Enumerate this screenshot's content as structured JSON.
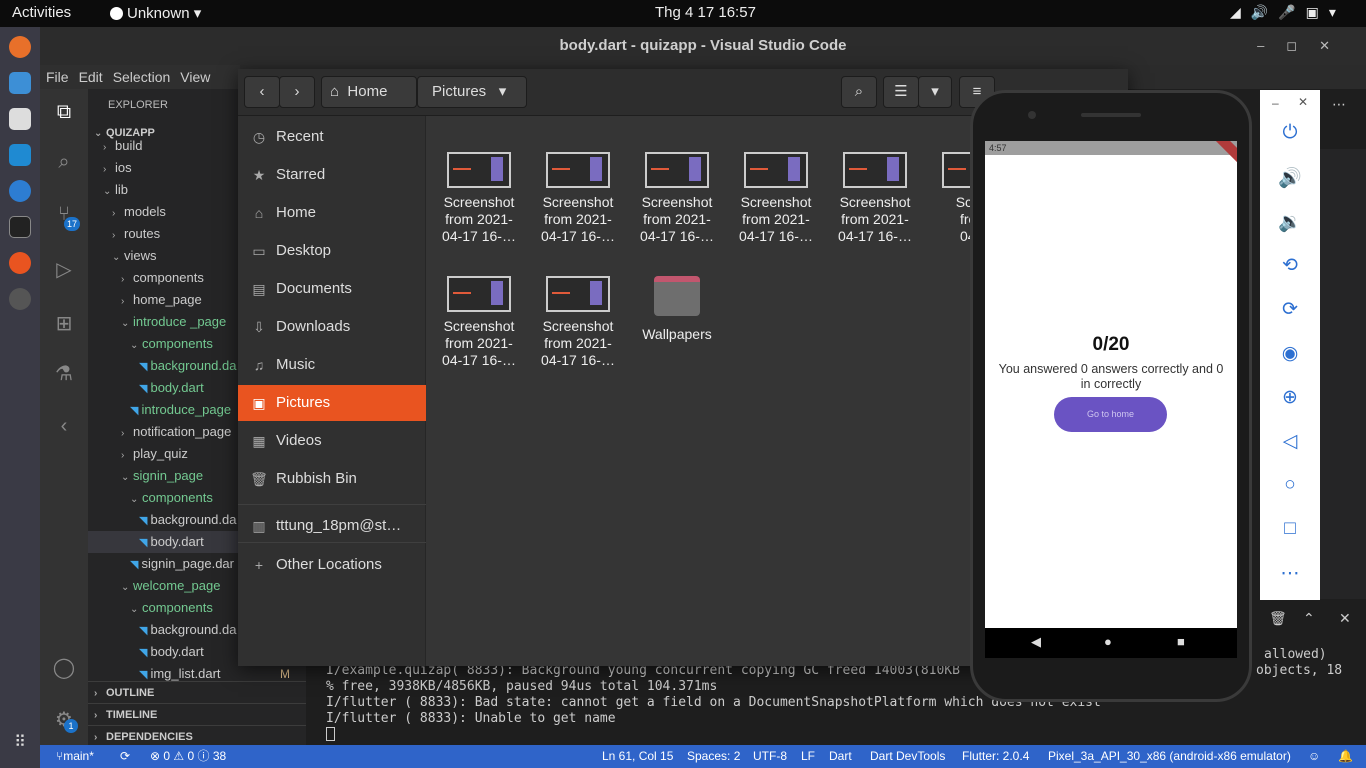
{
  "topbar": {
    "activities": "Activities",
    "app_name": "Unknown",
    "clock": "Thg 4 17  16:57"
  },
  "window": {
    "title": "body.dart - quizapp - Visual Studio Code"
  },
  "menu": [
    "File",
    "Edit",
    "Selection",
    "View"
  ],
  "explorer": {
    "header": "EXPLORER",
    "root": "QUIZAPP",
    "rows": [
      {
        "label": "build",
        "indent": 1,
        "kind": "folder-closed"
      },
      {
        "label": "ios",
        "indent": 1,
        "kind": "folder-closed"
      },
      {
        "label": "lib",
        "indent": 1,
        "kind": "folder-open"
      },
      {
        "label": "models",
        "indent": 2,
        "kind": "folder-closed"
      },
      {
        "label": "routes",
        "indent": 2,
        "kind": "folder-closed"
      },
      {
        "label": "views",
        "indent": 2,
        "kind": "folder-open"
      },
      {
        "label": "components",
        "indent": 3,
        "kind": "folder-closed"
      },
      {
        "label": "home_page",
        "indent": 3,
        "kind": "folder-closed"
      },
      {
        "label": "introduce _page",
        "indent": 3,
        "kind": "folder-open",
        "color": "#73c991"
      },
      {
        "label": "components",
        "indent": 4,
        "kind": "folder-open",
        "color": "#73c991"
      },
      {
        "label": "background.da",
        "indent": 5,
        "kind": "dart",
        "color": "#73c991"
      },
      {
        "label": "body.dart",
        "indent": 5,
        "kind": "dart",
        "color": "#73c991"
      },
      {
        "label": "introduce_page",
        "indent": 4,
        "kind": "dart",
        "color": "#73c991"
      },
      {
        "label": "notification_page",
        "indent": 3,
        "kind": "folder-closed"
      },
      {
        "label": "play_quiz",
        "indent": 3,
        "kind": "folder-closed"
      },
      {
        "label": "signin_page",
        "indent": 3,
        "kind": "folder-open",
        "color": "#73c991"
      },
      {
        "label": "components",
        "indent": 4,
        "kind": "folder-open",
        "color": "#73c991"
      },
      {
        "label": "background.da",
        "indent": 5,
        "kind": "dart"
      },
      {
        "label": "body.dart",
        "indent": 5,
        "kind": "dart",
        "selected": true
      },
      {
        "label": "signin_page.dar",
        "indent": 4,
        "kind": "dart"
      },
      {
        "label": "welcome_page",
        "indent": 3,
        "kind": "folder-open",
        "color": "#73c991"
      },
      {
        "label": "components",
        "indent": 4,
        "kind": "folder-open",
        "color": "#73c991"
      },
      {
        "label": "background.da",
        "indent": 5,
        "kind": "dart"
      },
      {
        "label": "body.dart",
        "indent": 5,
        "kind": "dart"
      },
      {
        "label": "img_list.dart",
        "indent": 5,
        "kind": "dart",
        "badge": "M"
      }
    ],
    "sections": [
      "OUTLINE",
      "TIMELINE",
      "DEPENDENCIES"
    ]
  },
  "activity_badges": {
    "source_control": "17",
    "settings": "1"
  },
  "files": {
    "breadcrumb": [
      "Home",
      "Pictures"
    ],
    "places": [
      {
        "label": "Recent",
        "icon": "clock-icon"
      },
      {
        "label": "Starred",
        "icon": "star-icon"
      },
      {
        "label": "Home",
        "icon": "home-icon"
      },
      {
        "label": "Desktop",
        "icon": "desktop-icon"
      },
      {
        "label": "Documents",
        "icon": "document-icon"
      },
      {
        "label": "Downloads",
        "icon": "download-icon"
      },
      {
        "label": "Music",
        "icon": "music-icon"
      },
      {
        "label": "Pictures",
        "icon": "picture-icon",
        "selected": true
      },
      {
        "label": "Videos",
        "icon": "video-icon"
      },
      {
        "label": "Rubbish Bin",
        "icon": "trash-icon"
      },
      {
        "label": "tttung_18pm@st…",
        "icon": "network-drive-icon"
      },
      {
        "label": "Other Locations",
        "icon": "plus-icon"
      }
    ],
    "items": [
      {
        "line1": "Screenshot",
        "line2": "from 2021-",
        "line3": "04-17 16-…",
        "type": "image"
      },
      {
        "line1": "Screenshot",
        "line2": "from 2021-",
        "line3": "04-17 16-…",
        "type": "image"
      },
      {
        "line1": "Screenshot",
        "line2": "from 2021-",
        "line3": "04-17 16-…",
        "type": "image"
      },
      {
        "line1": "Screenshot",
        "line2": "from 2021-",
        "line3": "04-17 16-…",
        "type": "image"
      },
      {
        "line1": "Screenshot",
        "line2": "from 2021-",
        "line3": "04-17 16-…",
        "type": "image"
      },
      {
        "line1": "Scree",
        "line2": "from",
        "line3": "04-1",
        "type": "image"
      },
      {
        "line1": "Screenshot",
        "line2": "from 2021-",
        "line3": "04-17 16-…",
        "type": "image"
      },
      {
        "line1": "Screenshot",
        "line2": "from 2021-",
        "line3": "04-17 16-…",
        "type": "image"
      },
      {
        "line1": "Wallpapers",
        "line2": "",
        "line3": "",
        "type": "folder"
      }
    ]
  },
  "terminal": {
    "lines": [
      "I/example.quizap( 8833): Background young concurrent copying GC freed 14003(810KB",
      "% free, 3938KB/4856KB, paused 94us total 104.371ms",
      "I/flutter ( 8833): Bad state: cannot get a field on a DocumentSnapshotPlatform which does not exist",
      "I/flutter ( 8833): Unable to get name"
    ],
    "right1": "allowed)",
    "right2": "objects, 18"
  },
  "phone": {
    "status_time": "4:57",
    "score": "0/20",
    "message": "You answered 0 answers correctly and 0 in correctly",
    "button": "Go to home"
  },
  "status": {
    "branch": "main*",
    "problems": "⊗ 0 ⚠ 0 ⓘ 38",
    "position": "Ln 61, Col 15",
    "spaces": "Spaces: 2",
    "encoding": "UTF-8",
    "eol": "LF",
    "language": "Dart",
    "devtools": "Dart DevTools",
    "flutter": "Flutter: 2.0.4",
    "device": "Pixel_3a_API_30_x86 (android-x86 emulator)"
  }
}
